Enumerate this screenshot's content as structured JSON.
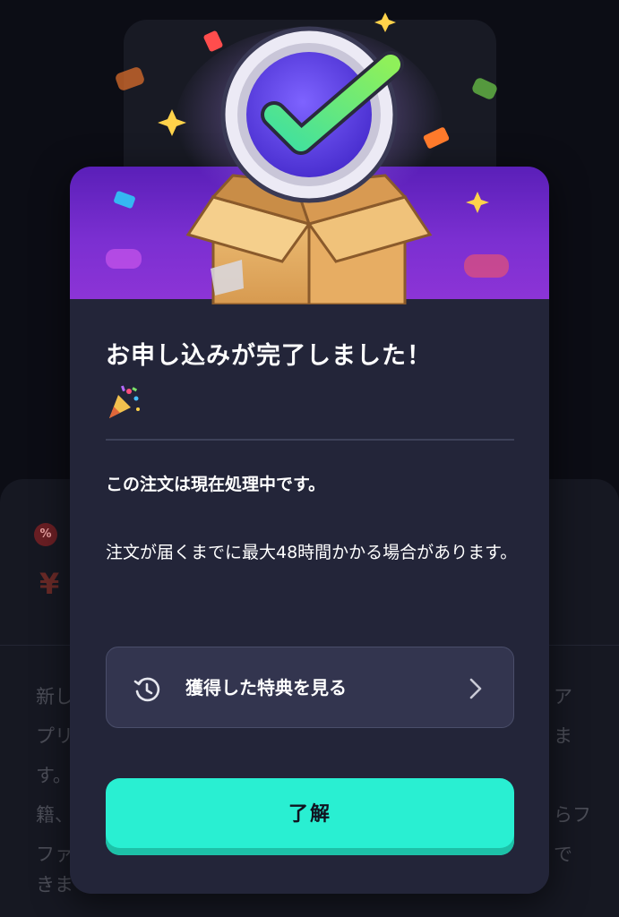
{
  "background": {
    "discount_icon": "%",
    "price_prefix": "¥",
    "description_lines": [
      "新し",
      "アプリ",
      "ます。",
      "す。",
      "籍、",
      "らファ",
      "ファイ",
      "でき",
      "できま"
    ]
  },
  "modal": {
    "title": "お申し込みが完了しました！",
    "title_emoji": "party-popper-icon",
    "processing_text": "この注文は現在処理中です。",
    "delivery_text": "注文が届くまでに最大48時間かかる場合があります。",
    "benefits_button": {
      "label": "獲得した特典を見る",
      "icon": "history-icon",
      "trailing_icon": "chevron-right-icon"
    },
    "ok_button": {
      "label": "了解"
    }
  },
  "colors": {
    "modal_bg": "#232539",
    "banner_purple": "#7b2fd1",
    "accent_teal": "#29efd2",
    "button_secondary_bg": "#33354f"
  }
}
